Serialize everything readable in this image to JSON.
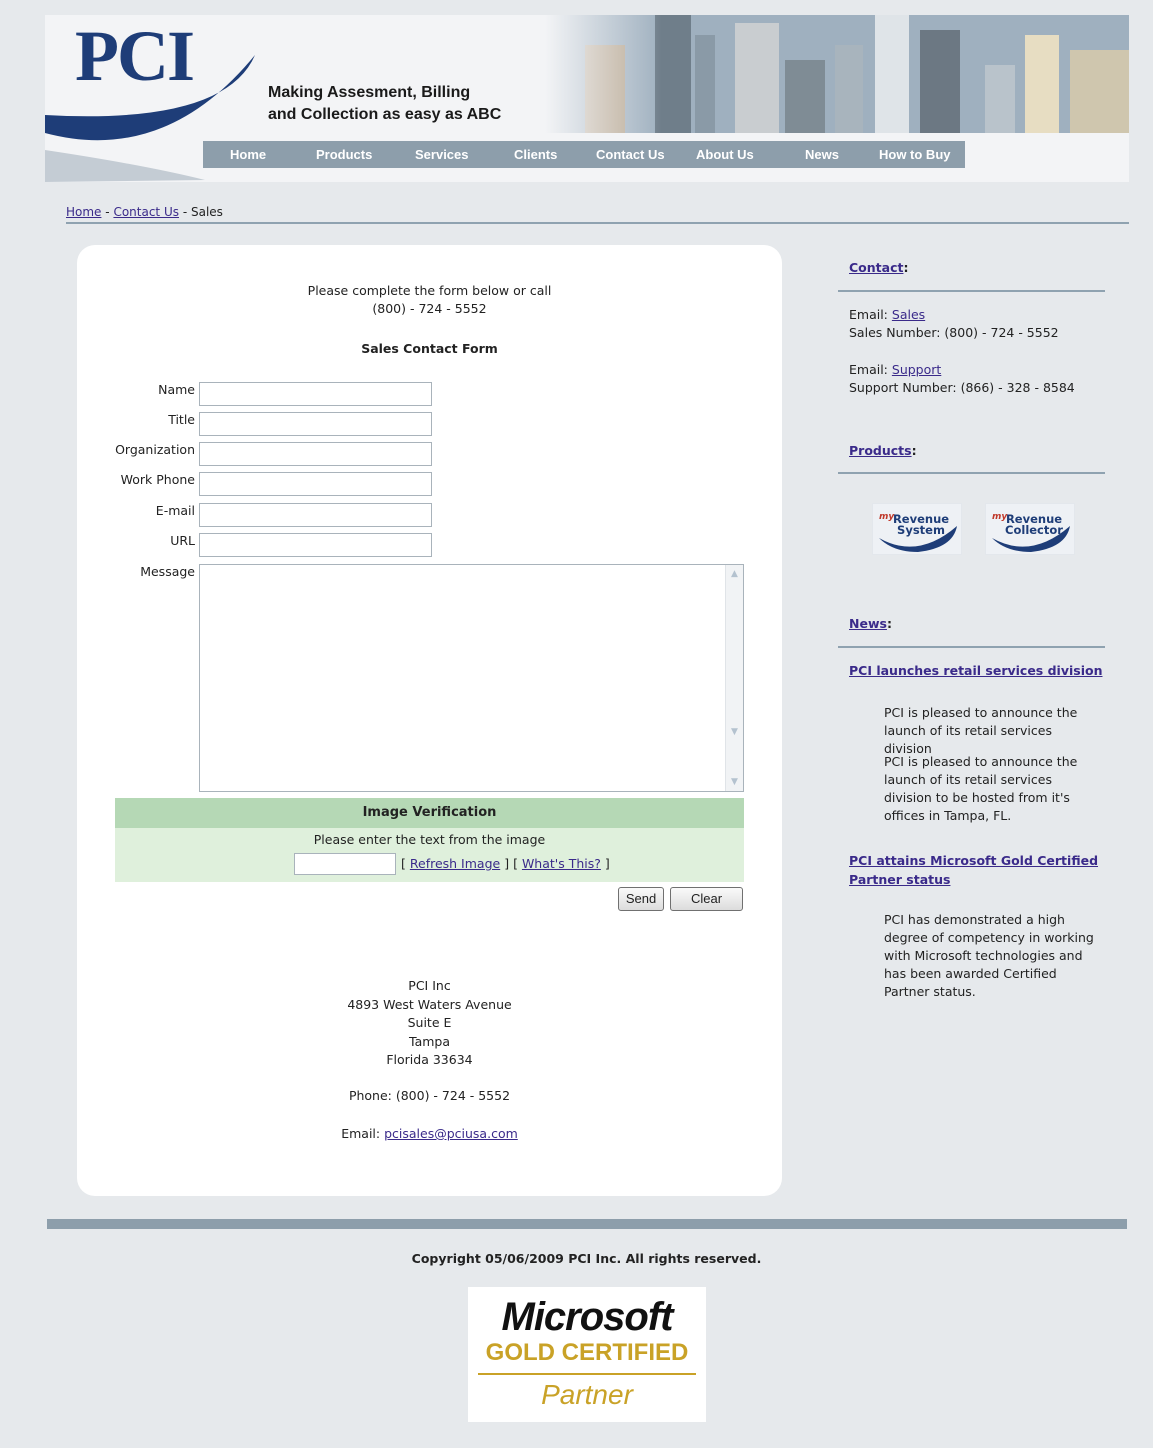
{
  "header": {
    "logo": "PCI",
    "tagline_line1": "Making Assesment, Billing",
    "tagline_line2": "and Collection as easy as ABC"
  },
  "nav": {
    "items": [
      "Home",
      "Products",
      "Services",
      "Clients",
      "Contact Us",
      "About Us",
      "News",
      "How to Buy"
    ]
  },
  "breadcrumb": {
    "home": "Home",
    "sep": "-",
    "contact": "Contact Us",
    "current": "Sales"
  },
  "form": {
    "intro_line1": "Please complete the form below or call",
    "intro_line2": "(800) - 724 - 5552",
    "title": "Sales Contact Form",
    "fields": [
      "Name",
      "Title",
      "Organization",
      "Work Phone",
      "E-mail",
      "URL"
    ],
    "message_label": "Message",
    "verification": {
      "title": "Image Verification",
      "instruction": "Please enter the text from the image",
      "bracket_open": "[",
      "bracket_close": "]",
      "refresh": "Refresh Image",
      "whats_this": "What's This?"
    },
    "send_label": "Send",
    "clear_label": "Clear"
  },
  "address": {
    "company": "PCI Inc",
    "street": "4893 West Waters Avenue",
    "suite": "Suite E",
    "city": "Tampa",
    "state_zip": "Florida 33634",
    "phone": "Phone: (800) - 724 - 5552",
    "email_label": "Email:",
    "email": "pcisales@pciusa.com"
  },
  "sidebar": {
    "contact_head": "Contact",
    "colon": ":",
    "email_label": "Email:",
    "sales_link": "Sales",
    "sales_number": "Sales Number: (800) - 724 - 5552",
    "support_link": "Support",
    "support_number": "Support Number: (866) - 328 - 8584",
    "products_head": "Products",
    "products": [
      {
        "prefix": "my",
        "line1": "Revenue",
        "line2": "System"
      },
      {
        "prefix": "my",
        "line1": "Revenue",
        "line2": "Collector"
      }
    ],
    "news_head": "News",
    "news": [
      {
        "title": "PCI launches retail services division",
        "para1": "PCI is pleased to announce the launch of its retail services division",
        "para2": "PCI is pleased to announce the launch of its retail services division to be hosted from it's offices in Tampa, FL."
      },
      {
        "title_line1": "PCI attains Microsoft Gold Certified",
        "title_line2": "Partner status",
        "para1": "PCI has demonstrated a high degree of competency in working with Microsoft technologies and has been awarded Certified Partner status."
      }
    ]
  },
  "footer": {
    "copyright": "Copyright 05/06/2009 PCI Inc. All rights reserved.",
    "badge_name": "Microsoft",
    "badge_gold": "GOLD CERTIFIED",
    "badge_partner": "Partner"
  },
  "colors": {
    "nav_bg": "#8d9eab",
    "brand_blue": "#1e3d78",
    "verification_head": "#b5d8b5",
    "verification_body": "#dff0dc",
    "gold": "#c9a227"
  }
}
